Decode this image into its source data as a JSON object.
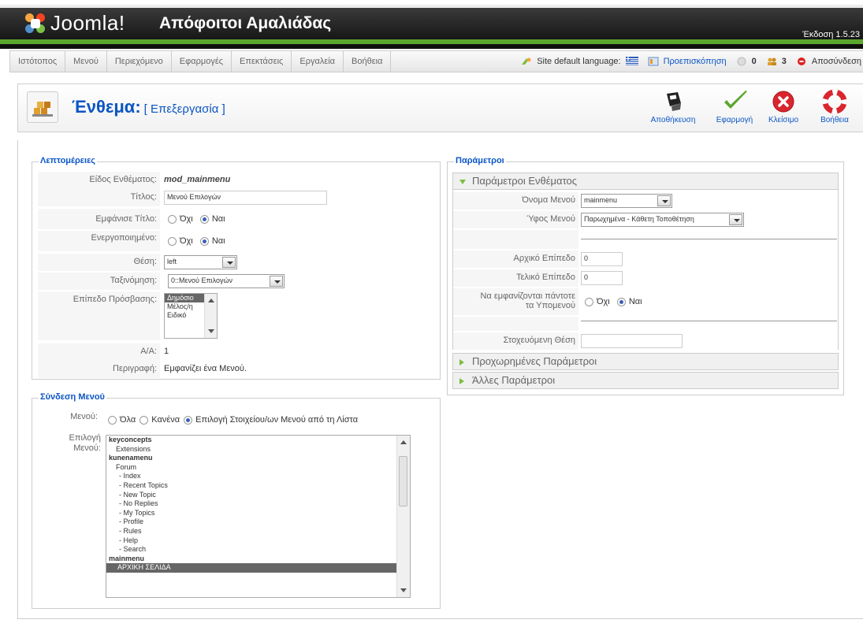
{
  "header": {
    "logo_text": "Joomla!",
    "site_title": "Απόφοιτοι Αμαλιάδας",
    "version": "Έκδοση 1.5.23"
  },
  "menubar": {
    "items": [
      "Ιστότοπος",
      "Μενού",
      "Περιεχόμενο",
      "Εφαρμογές",
      "Επεκτάσεις",
      "Εργαλεία",
      "Βοήθεια"
    ],
    "status": {
      "default_language": "Site default language:",
      "preview": "Προεπισκόπηση",
      "messages": "0",
      "users": "3",
      "logout": "Αποσύνδεση"
    }
  },
  "toolbar": {
    "title": "Ένθεμα:",
    "subtitle": "[ Επεξεργασία ]",
    "buttons": {
      "save": "Αποθήκευση",
      "apply": "Εφαρμογή",
      "close": "Κλείσιμο",
      "help": "Βοήθεια"
    }
  },
  "details": {
    "legend": "Λεπτομέρειες",
    "module_type_label": "Είδος Ενθέματος:",
    "module_type": "mod_mainmenu",
    "title_label": "Τίτλος:",
    "title_value": "Μενού Επιλογών",
    "show_title_label": "Εμφάνισε Τίτλο:",
    "no": "Όχι",
    "yes": "Ναι",
    "enabled_label": "Ενεργοποιημένο:",
    "position_label": "Θέση:",
    "position_value": "left",
    "order_label": "Ταξινόμηση:",
    "order_value": "0::Μενού Επιλογών",
    "access_label": "Επίπεδο Πρόσβασης:",
    "access_options": [
      "Δημόσιο",
      "Μέλος/η",
      "Ειδικό"
    ],
    "id_label": "Α/Α:",
    "id_value": "1",
    "description_label": "Περιγραφή:",
    "description_value": "Εμφανίζει ένα Μενού."
  },
  "menu_assignment": {
    "legend": "Σύνδεση Μενού",
    "menus_label": "Μενού:",
    "options": [
      "Όλα",
      "Κανένα",
      "Επιλογή Στοιχείου/ων Μενού από τη Λίστα"
    ],
    "selection_label_1": "Επιλογή",
    "selection_label_2": "Μενού:",
    "list": [
      {
        "text": "keyconcepts",
        "bold": true
      },
      {
        "text": "Extensions",
        "bold": false
      },
      {
        "text": "kunenamenu",
        "bold": true
      },
      {
        "text": "Forum",
        "bold": false
      },
      {
        "text": "- Index",
        "bold": false
      },
      {
        "text": "- Recent Topics",
        "bold": false
      },
      {
        "text": "- New Topic",
        "bold": false
      },
      {
        "text": "- No Replies",
        "bold": false
      },
      {
        "text": "- My Topics",
        "bold": false
      },
      {
        "text": "- Profile",
        "bold": false
      },
      {
        "text": "- Rules",
        "bold": false
      },
      {
        "text": "- Help",
        "bold": false
      },
      {
        "text": "- Search",
        "bold": false
      },
      {
        "text": "mainmenu",
        "bold": true
      },
      {
        "text": "ΑΡΧΙΚΗ ΣΕΛΙΔΑ",
        "bold": false
      }
    ]
  },
  "parameters": {
    "legend": "Παράμετροι",
    "module_params_title": "Παράμετροι Ενθέματος",
    "menu_name_label": "Όνομα Μενού",
    "menu_name_value": "mainmenu",
    "menu_style_label": "Ύφος Μενού",
    "menu_style_value": "Παρωχημένα - Κάθετη Τοποθέτηση",
    "start_level_label": "Αρχικό Επίπεδο",
    "start_level_value": "0",
    "end_level_label": "Τελικό Επίπεδο",
    "end_level_value": "0",
    "always_show_label_1": "Να εμφανίζονται πάντοτε",
    "always_show_label_2": "τα Υπομενού",
    "target_position_label": "Στοχευόμενη Θέση",
    "target_position_value": "",
    "advanced_title": "Προχωρημένες Παράμετροι",
    "other_title": "Άλλες Παράμετροι"
  },
  "colors": {
    "accent_blue": "#0b55c4",
    "header_green": "#5aa72e"
  }
}
